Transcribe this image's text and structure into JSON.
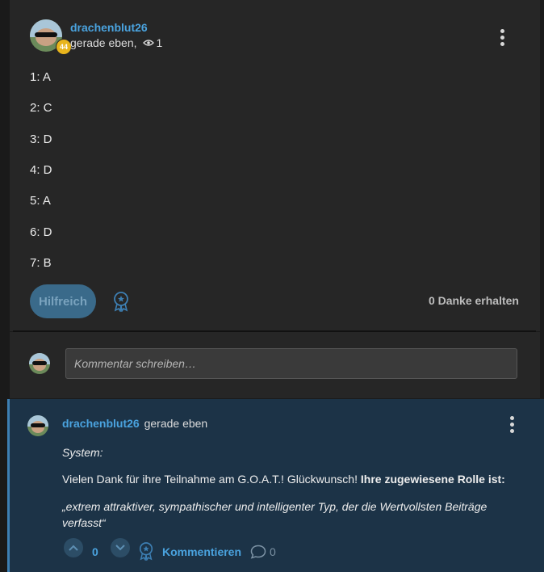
{
  "post": {
    "author": "drachenblut26",
    "level": "44",
    "time": "gerade eben,",
    "views": "1",
    "answers": [
      "1: A",
      "2: C",
      "3: D",
      "4: D",
      "5: A",
      "6: D",
      "7: B"
    ],
    "helpful_label": "Hilfreich",
    "thanks": "0 Danke erhalten"
  },
  "comment_box": {
    "placeholder": "Kommentar schreiben…"
  },
  "reply": {
    "author": "drachenblut26",
    "time": "gerade eben",
    "system_label": "System:",
    "text_plain": "Vielen Dank für ihre Teilnahme am G.O.A.T.! Glückwunsch! ",
    "text_bold": "Ihre zugewiesene Rolle ist:",
    "quote_line1": "„extrem attraktiver, sympathischer und intelligenter Typ, der die Wertvollsten Beiträge",
    "quote_line2": "verfasst“",
    "votes": "0",
    "comment_label": "Kommentieren",
    "comment_count": "0"
  },
  "colors": {
    "link": "#4aa3df",
    "reply_bg": "#1c3347",
    "post_bg": "#262626",
    "level_badge": "#e8b41c"
  },
  "icons": [
    "eye-icon",
    "more-vert-icon",
    "award-icon",
    "chevron-up-icon",
    "chevron-down-icon",
    "speech-bubble-icon"
  ]
}
